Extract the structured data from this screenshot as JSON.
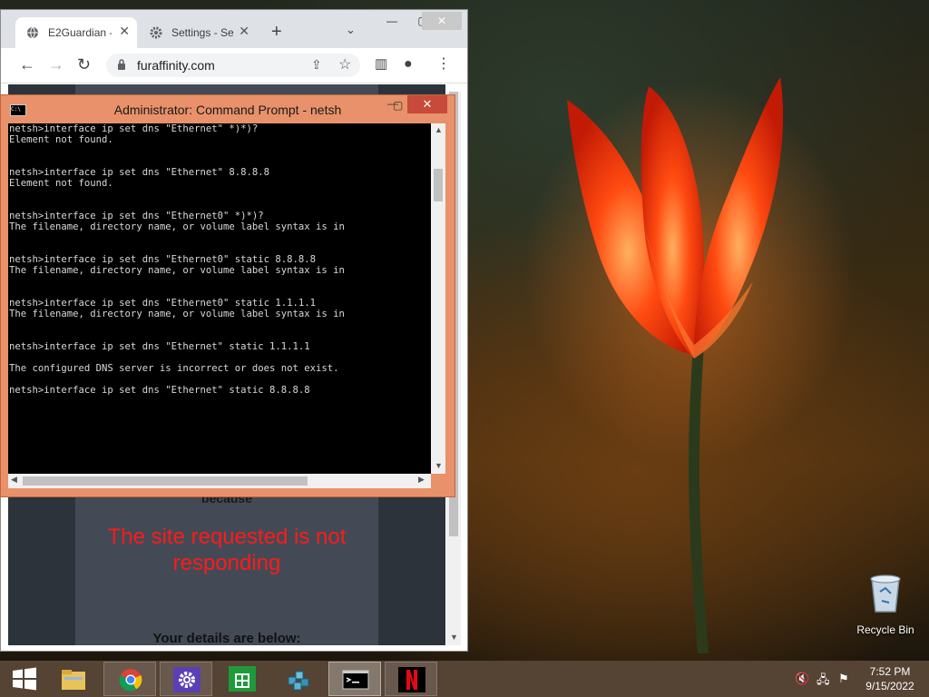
{
  "desktop": {
    "recycle_bin_label": "Recycle Bin"
  },
  "chrome": {
    "tabs": [
      {
        "title": "E2Guardian -",
        "favicon": "globe-icon"
      },
      {
        "title": "Settings - Se",
        "favicon": "gear-icon"
      }
    ],
    "new_tab_label": "+",
    "url": "furaffinity.com",
    "page": {
      "because": "because",
      "message": "The site requested is not responding",
      "details": "Your details are below:"
    },
    "colors": {
      "block_message": "#ff1a1a",
      "panel": "#434a55"
    }
  },
  "cmd": {
    "title": "Administrator: Command Prompt - netsh",
    "console_text": "netsh>interface ip set dns \"Ethernet\" *)*)?\nElement not found.\n\n\nnetsh>interface ip set dns \"Ethernet\" 8.8.8.8\nElement not found.\n\n\nnetsh>interface ip set dns \"Ethernet0\" *)*)?\nThe filename, directory name, or volume label syntax is in\n\n\nnetsh>interface ip set dns \"Ethernet0\" static 8.8.8.8\nThe filename, directory name, or volume label syntax is in\n\n\nnetsh>interface ip set dns \"Ethernet0\" static 1.1.1.1\nThe filename, directory name, or volume label syntax is in\n\n\nnetsh>interface ip set dns \"Ethernet\" static 1.1.1.1\n\nThe configured DNS server is incorrect or does not exist.\n\nnetsh>interface ip set dns \"Ethernet\" static 8.8.8.8",
    "colors": {
      "frame": "#e8916a",
      "close": "#c74a3a"
    }
  },
  "taskbar": {
    "items": [
      {
        "name": "file-explorer"
      },
      {
        "name": "chrome"
      },
      {
        "name": "settings"
      },
      {
        "name": "store"
      },
      {
        "name": "registry-editor"
      },
      {
        "name": "command-prompt"
      },
      {
        "name": "netflix"
      }
    ],
    "clock": {
      "time": "7:52 PM",
      "date": "9/15/2022"
    }
  }
}
